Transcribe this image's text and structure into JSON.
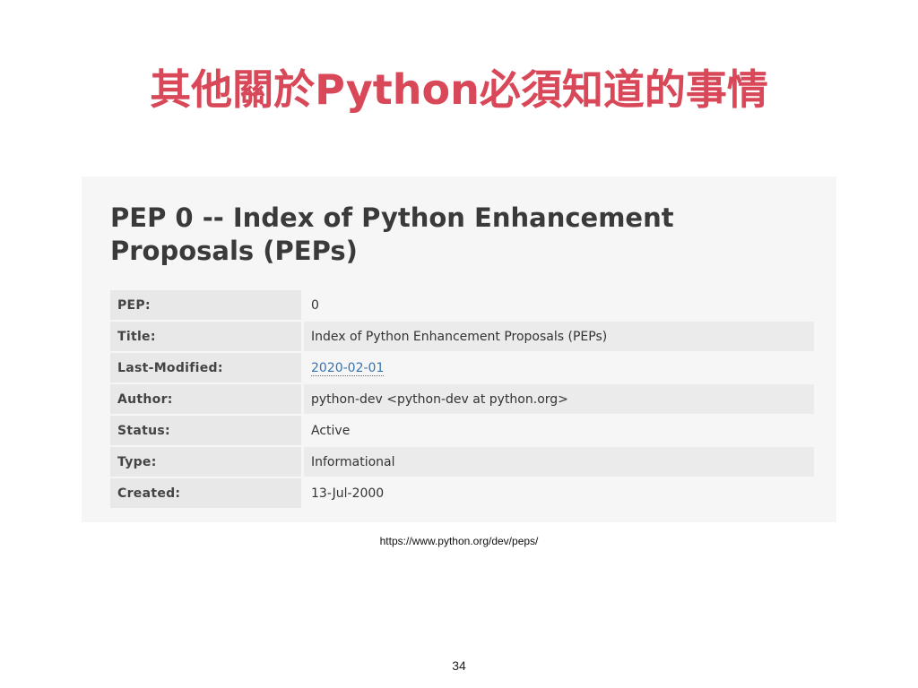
{
  "slide": {
    "title": "其他關於Python必須知道的事情",
    "title_color": "#d84858",
    "source_url": "https://www.python.org/dev/peps/",
    "page_number": "34"
  },
  "pep_page": {
    "heading": "PEP 0 -- Index of Python Enhancement Proposals (PEPs)",
    "link_color": "#3873ad",
    "rows": [
      {
        "label": "PEP:",
        "value": "0"
      },
      {
        "label": "Title:",
        "value": "Index of Python Enhancement Proposals (PEPs)"
      },
      {
        "label": "Last-Modified:",
        "value": "2020-02-01"
      },
      {
        "label": "Author:",
        "value": "python-dev <python-dev at python.org>"
      },
      {
        "label": "Status:",
        "value": "Active"
      },
      {
        "label": "Type:",
        "value": "Informational"
      },
      {
        "label": "Created:",
        "value": "13-Jul-2000"
      }
    ]
  }
}
